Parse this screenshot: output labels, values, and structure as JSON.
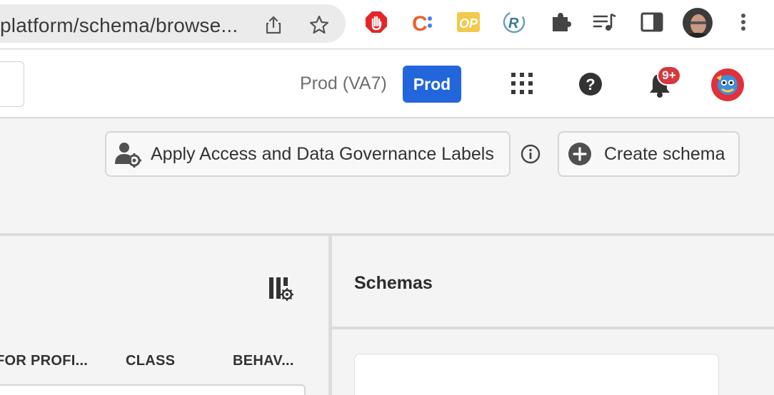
{
  "browser": {
    "url": "platform/schema/browse...",
    "share_icon": "share-icon",
    "bookmark_icon": "star-icon",
    "extensions": [
      "adblock-icon",
      "c-extension-icon",
      "op-extension-icon",
      "r-extension-icon",
      "puzzle-icon",
      "media-playlist-icon",
      "sidepanel-icon",
      "profile-photo-icon"
    ],
    "menu_icon": "kebab-menu-icon"
  },
  "header": {
    "env_label": "Prod (VA7)",
    "env_button": "Prod",
    "notification_badge": "9+"
  },
  "toolbar": {
    "apply_labels_button": "Apply Access and Data Governance Labels",
    "create_schema_button": "Create schema"
  },
  "left_panel": {
    "columns": [
      "FOR PROFI...",
      "CLASS",
      "BEHAV..."
    ]
  },
  "right_panel": {
    "title": "Schemas"
  },
  "colors": {
    "accent": "#2366dc",
    "badge": "#d7373f"
  }
}
